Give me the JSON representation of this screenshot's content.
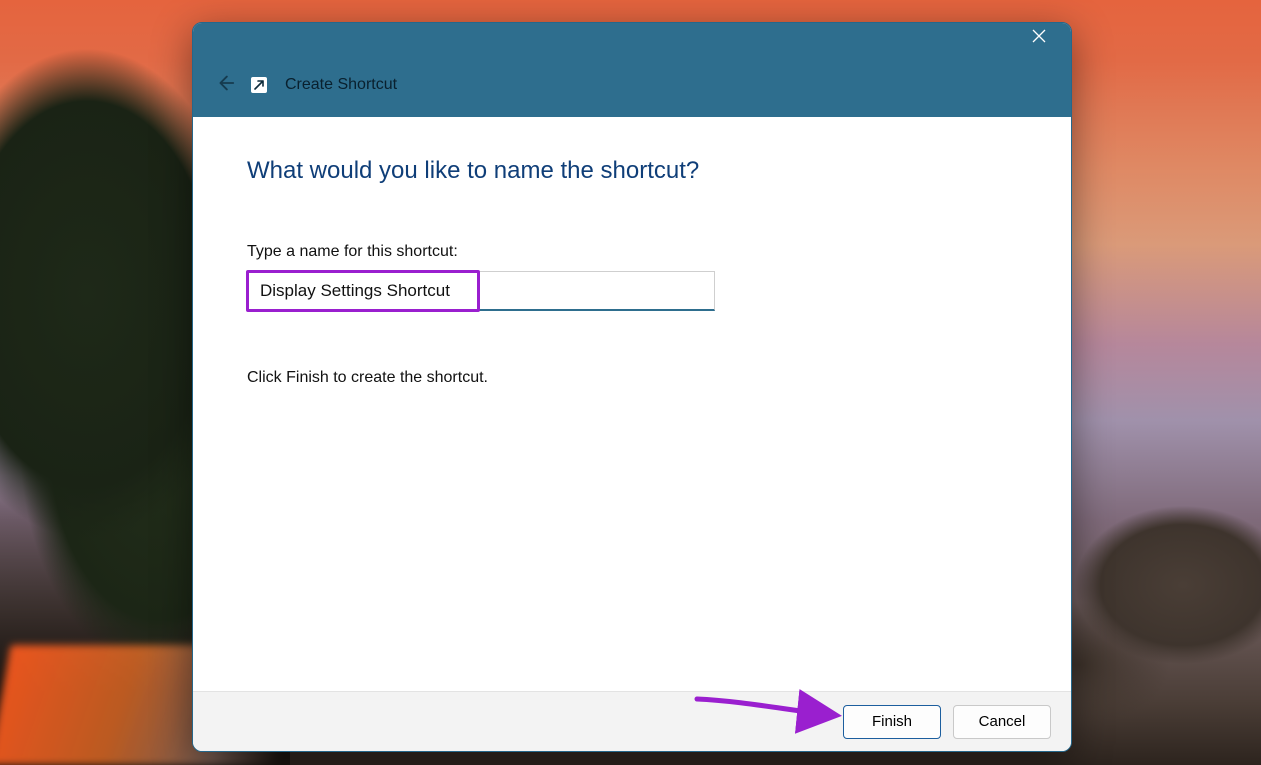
{
  "window": {
    "nav_title": "Create Shortcut"
  },
  "content": {
    "heading": "What would you like to name the shortcut?",
    "field_label": "Type a name for this shortcut:",
    "input_value": "Display Settings Shortcut",
    "instruction": "Click Finish to create the shortcut."
  },
  "footer": {
    "finish_label": "Finish",
    "cancel_label": "Cancel"
  },
  "annotation": {
    "highlight_color": "#9a1fcf"
  }
}
